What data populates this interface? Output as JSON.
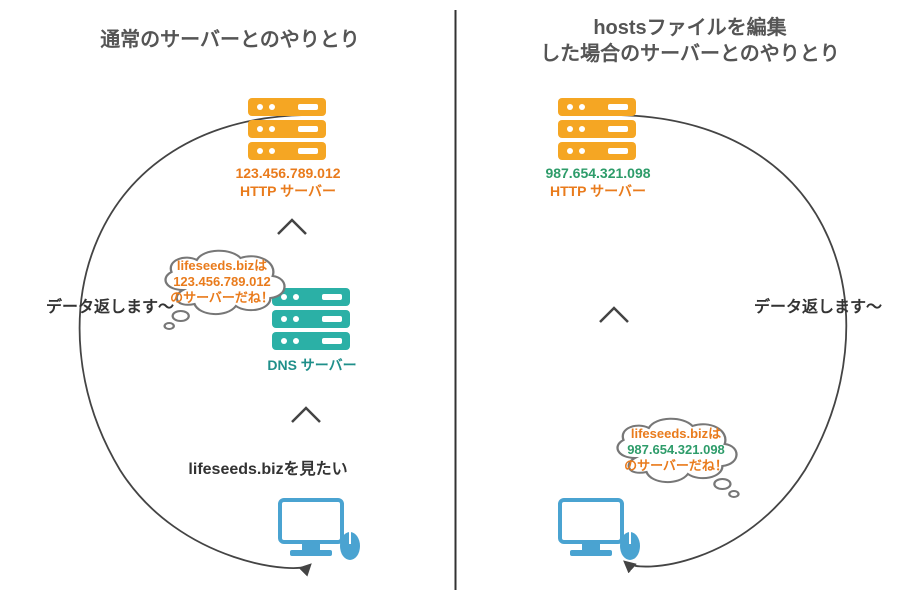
{
  "left": {
    "title": "通常のサーバーとのやりとり",
    "http_ip": "123.456.789.012",
    "http_label": "HTTP サーバー",
    "dns_label": "DNS サーバー",
    "cloud_line1": "lifeseeds.bizは",
    "cloud_line2": "123.456.789.012",
    "cloud_line3": "のサーバーだね！",
    "request_text": "lifeseeds.bizを見たい",
    "response_text": "データ返します～"
  },
  "right": {
    "title_line1": "hostsファイルを編集",
    "title_line2": "した場合のサーバーとのやりとり",
    "http_ip": "987.654.321.098",
    "http_label": "HTTP サーバー",
    "cloud_line1": "lifeseeds.bizは",
    "cloud_line2": "987.654.321.098",
    "cloud_line3": "のサーバーだね！",
    "response_text": "データ返します～"
  },
  "colors": {
    "orange": "#f5a623",
    "orange_text": "#e97b1c",
    "green": "#2e9c6a",
    "teal": "#1f8f8a",
    "blue": "#4aa3d1",
    "gray_stroke": "#444"
  }
}
